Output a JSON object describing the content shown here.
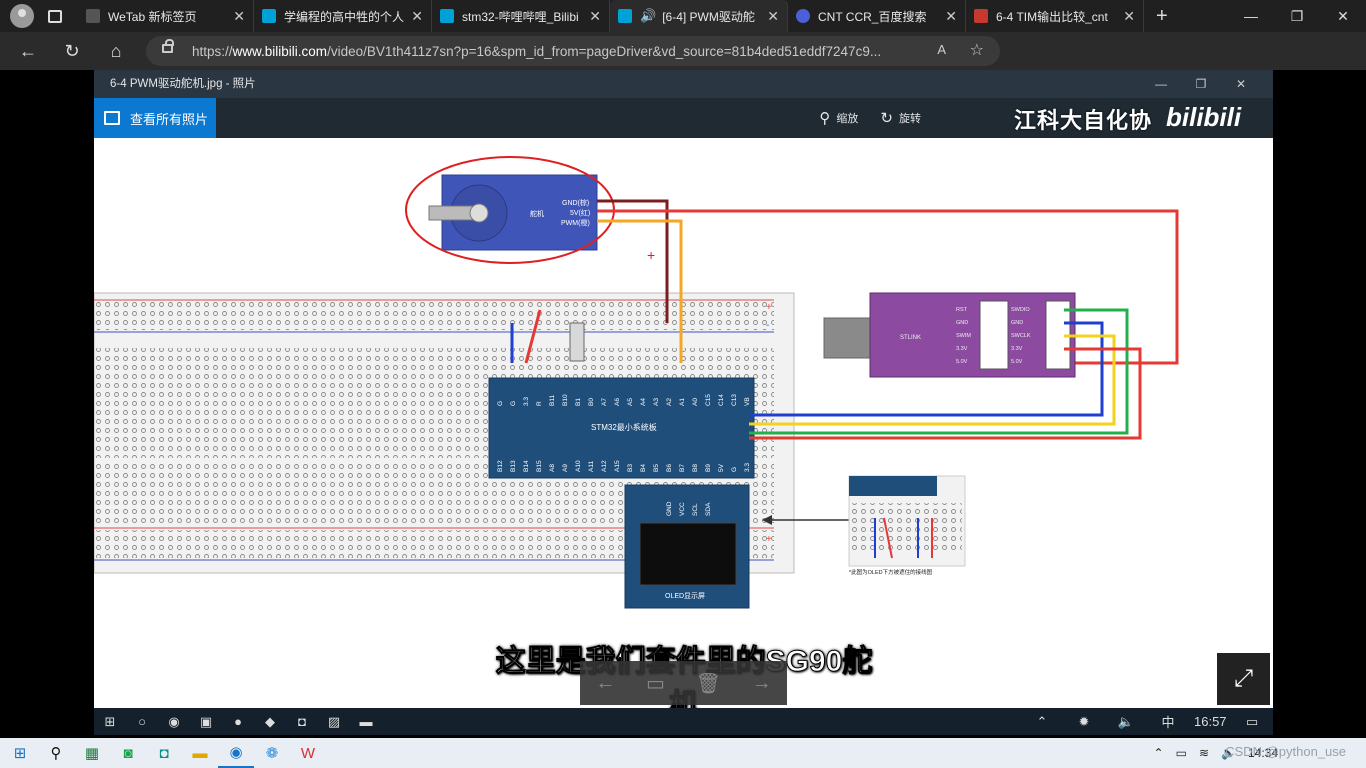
{
  "tabs": [
    {
      "title": "WeTab 新标签页",
      "favicon": "wetab-icon",
      "color": "#555555",
      "active": false
    },
    {
      "title": "学编程的高中牲的个人",
      "favicon": "bilibili-tv-icon",
      "color": "#00a1d6",
      "active": false
    },
    {
      "title": "stm32-哔哩哔哩_Bilibi",
      "favicon": "bilibili-tv-icon",
      "color": "#00a1d6",
      "active": false
    },
    {
      "title": "[6-4] PWM驱动舵",
      "favicon": "bilibili-tv-icon",
      "color": "#00a1d6",
      "active": true
    },
    {
      "title": "CNT CCR_百度搜索",
      "favicon": "baidu-icon",
      "color": "#4b5fd6",
      "active": false
    },
    {
      "title": "6-4 TIM输出比较_cnt",
      "favicon": "csdn-icon",
      "color": "#c7392c",
      "active": false
    }
  ],
  "address": {
    "prefix": "https://",
    "domain": "www.bilibili.com",
    "path": "/video/BV1th411z7sn?p=16&spm_id_from=pageDriver&vd_source=81b4ded51eddf7247c9..."
  },
  "photo": {
    "window_title": "6-4 PWM驱动舵机.jpg - 照片",
    "all_photos": "查看所有照片",
    "tools": [
      {
        "label": "缩放",
        "icon": "zoom-icon"
      },
      {
        "label": "旋转",
        "icon": "rotate-icon"
      }
    ],
    "watermark": "江科大自化协",
    "bili_logo": "bilibili"
  },
  "diagram": {
    "servo_label": "舵机",
    "servo_pins": [
      "GND(棕)",
      "5V(红)",
      "PWM(橙)"
    ],
    "plus_sign": "+",
    "board_label": "STM32最小系统板",
    "board_top_pins": [
      "G",
      "G",
      "3.3",
      "R",
      "B11",
      "B10",
      "B1",
      "B0",
      "A7",
      "A6",
      "A5",
      "A4",
      "A3",
      "A2",
      "A1",
      "A0",
      "C15",
      "C14",
      "C13",
      "VB"
    ],
    "board_bottom_pins": [
      "B12",
      "B13",
      "B14",
      "B15",
      "A8",
      "A9",
      "A10",
      "A11",
      "A12",
      "A15",
      "B3",
      "B4",
      "B5",
      "B6",
      "B7",
      "B8",
      "B9",
      "5V",
      "G",
      "3.3"
    ],
    "stlink_label": "STLINK",
    "stlink_left_pins": [
      "RST",
      "GND",
      "SWIM",
      "3.3V",
      "5.0V"
    ],
    "stlink_right_pins": [
      "SWDIO",
      "GND",
      "SWCLK",
      "3.3V",
      "5.0V"
    ],
    "oled_pins": [
      "GND",
      "VCC",
      "SCL",
      "SDA"
    ],
    "oled_label": "OLED显示屏",
    "inset_note": "*此图为OLED下方被遮住的接线图"
  },
  "subtitle": "这里是我们套件里的SG90舵机",
  "inner_taskbar": {
    "time": "16:57",
    "ime": "中"
  },
  "taskbar": {
    "time": "14:34",
    "watermark": "CSDN @python_use"
  },
  "colors": {
    "accent": "#0b78d1",
    "wire_red": "#e53935",
    "wire_blue": "#1e3fcf",
    "wire_yellow": "#f3d21b",
    "wire_green": "#22b04b"
  }
}
